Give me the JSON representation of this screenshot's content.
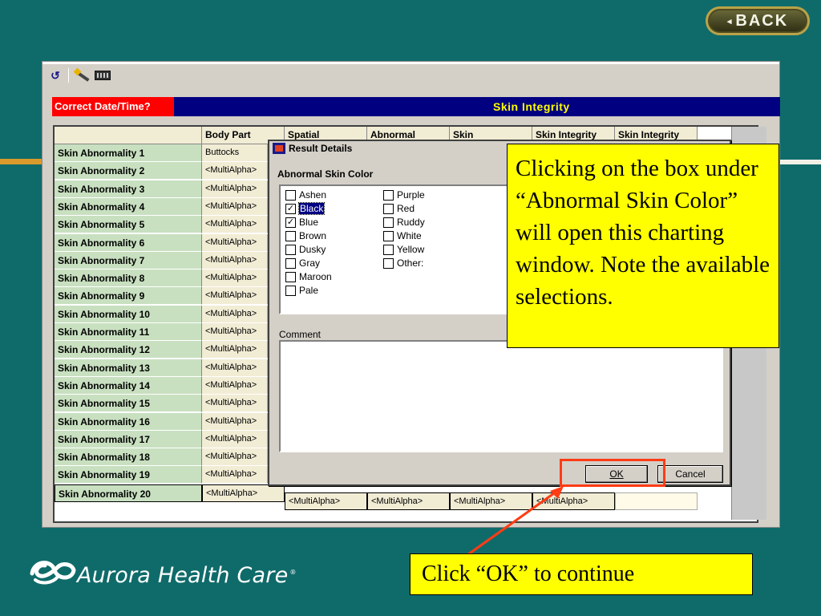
{
  "slide": {
    "back_label": "BACK",
    "back_arrow": "◂",
    "callout_main": "Clicking on the box under “Abnormal Skin Color” will open this charting window. Note the available selections.",
    "callout_ok": "Click “OK” to continue",
    "logo_text": "Aurora Health Care",
    "logo_mark": "®",
    "colors": {
      "background": "#0f6b6a",
      "callout": "#ffff00",
      "highlight": "#ff3c14"
    }
  },
  "app": {
    "toolbar": {
      "refresh_icon": "↺"
    },
    "correct_date_label": "Correct Date/Time?",
    "section_title": "Skin Integrity",
    "columns": [
      "Body Part",
      "Spatial",
      "Abnormal",
      "Skin",
      "Skin Integrity",
      "Skin Integrity"
    ],
    "rows": [
      {
        "label": "Skin Abnormality 1",
        "body_part": "Buttocks"
      },
      {
        "label": "Skin Abnormality 2",
        "body_part": "<MultiAlpha>"
      },
      {
        "label": "Skin Abnormality 3",
        "body_part": "<MultiAlpha>"
      },
      {
        "label": "Skin Abnormality 4",
        "body_part": "<MultiAlpha>"
      },
      {
        "label": "Skin Abnormality 5",
        "body_part": "<MultiAlpha>"
      },
      {
        "label": "Skin Abnormality 6",
        "body_part": "<MultiAlpha>"
      },
      {
        "label": "Skin Abnormality 7",
        "body_part": "<MultiAlpha>"
      },
      {
        "label": "Skin Abnormality 8",
        "body_part": "<MultiAlpha>"
      },
      {
        "label": "Skin Abnormality 9",
        "body_part": "<MultiAlpha>"
      },
      {
        "label": "Skin Abnormality 10",
        "body_part": "<MultiAlpha>"
      },
      {
        "label": "Skin Abnormality 11",
        "body_part": "<MultiAlpha>"
      },
      {
        "label": "Skin Abnormality 12",
        "body_part": "<MultiAlpha>"
      },
      {
        "label": "Skin Abnormality 13",
        "body_part": "<MultiAlpha>"
      },
      {
        "label": "Skin Abnormality 14",
        "body_part": "<MultiAlpha>"
      },
      {
        "label": "Skin Abnormality 15",
        "body_part": "<MultiAlpha>"
      },
      {
        "label": "Skin Abnormality 16",
        "body_part": "<MultiAlpha>"
      },
      {
        "label": "Skin Abnormality 17",
        "body_part": "<MultiAlpha>"
      },
      {
        "label": "Skin Abnormality 18",
        "body_part": "<MultiAlpha>"
      },
      {
        "label": "Skin Abnormality 19",
        "body_part": "<MultiAlpha>"
      },
      {
        "label": "Skin Abnormality 20",
        "body_part": "<MultiAlpha>"
      }
    ],
    "row20_cells": [
      "<MultiAlpha>",
      "<MultiAlpha>",
      "<MultiAlpha>",
      "<MultiAlpha>"
    ],
    "dialog": {
      "title": "Result Details",
      "group_label": "Abnormal Skin Color",
      "options": [
        {
          "label": "Ashen",
          "checked": false,
          "selected": false
        },
        {
          "label": "Black",
          "checked": true,
          "selected": true
        },
        {
          "label": "Blue",
          "checked": true,
          "selected": false
        },
        {
          "label": "Brown",
          "checked": false,
          "selected": false
        },
        {
          "label": "Dusky",
          "checked": false,
          "selected": false
        },
        {
          "label": "Gray",
          "checked": false,
          "selected": false
        },
        {
          "label": "Maroon",
          "checked": false,
          "selected": false
        },
        {
          "label": "Pale",
          "checked": false,
          "selected": false
        },
        {
          "label": "Purple",
          "checked": false,
          "selected": false
        },
        {
          "label": "Red",
          "checked": false,
          "selected": false
        },
        {
          "label": "Ruddy",
          "checked": false,
          "selected": false
        },
        {
          "label": "White",
          "checked": false,
          "selected": false
        },
        {
          "label": "Yellow",
          "checked": false,
          "selected": false
        },
        {
          "label": "Other:",
          "checked": false,
          "selected": false
        }
      ],
      "comment_label": "Comment",
      "ok_label": "OK",
      "cancel_label": "Cancel"
    }
  }
}
